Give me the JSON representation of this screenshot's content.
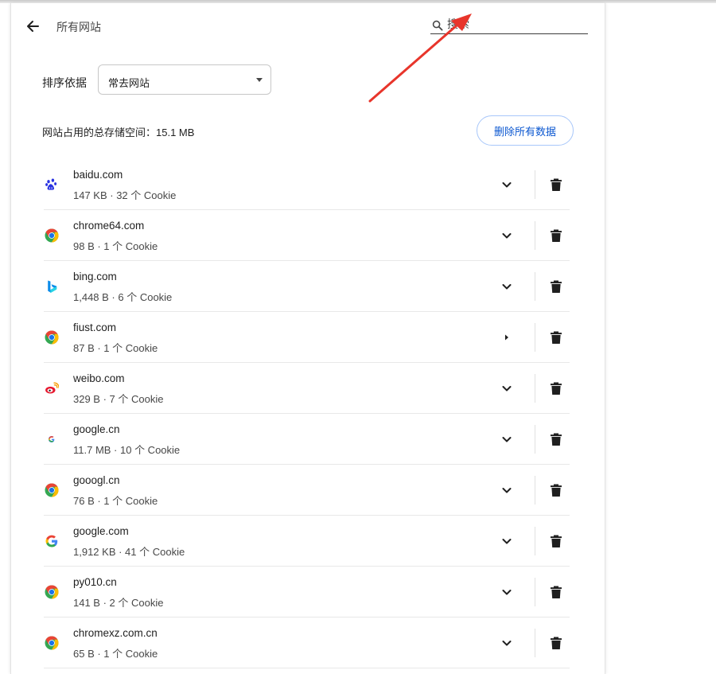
{
  "header": {
    "title": "所有网站",
    "search_placeholder": "搜索"
  },
  "sort": {
    "label": "排序依据",
    "selected": "常去网站"
  },
  "storage_summary": "网站占用的总存储空间：15.1 MB",
  "delete_all_label": "删除所有数据",
  "colors": {
    "accent_blue": "#0b57d0",
    "button_border": "#a8c7fa",
    "annotation_arrow": "#e8352b"
  },
  "sites": [
    {
      "name": "baidu.com",
      "meta": "147 KB · 32 个 Cookie",
      "icon": "baidu-paw-icon",
      "expand": "chevron-down-icon"
    },
    {
      "name": "chrome64.com",
      "meta": "98 B · 1 个 Cookie",
      "icon": "chrome-icon",
      "expand": "chevron-down-icon"
    },
    {
      "name": "bing.com",
      "meta": "1,448 B · 6 个 Cookie",
      "icon": "bing-icon",
      "expand": "chevron-down-icon"
    },
    {
      "name": "fiust.com",
      "meta": "87 B · 1 个 Cookie",
      "icon": "chrome-icon",
      "expand": "caret-right-icon"
    },
    {
      "name": "weibo.com",
      "meta": "329 B · 7 个 Cookie",
      "icon": "weibo-icon",
      "expand": "chevron-down-icon"
    },
    {
      "name": "google.cn",
      "meta": "11.7 MB · 10 个 Cookie",
      "icon": "google-small-icon",
      "expand": "chevron-down-icon"
    },
    {
      "name": "gooogl.cn",
      "meta": "76 B · 1 个 Cookie",
      "icon": "chrome-icon",
      "expand": "chevron-down-icon"
    },
    {
      "name": "google.com",
      "meta": "1,912 KB · 41 个 Cookie",
      "icon": "google-icon",
      "expand": "chevron-down-icon"
    },
    {
      "name": "py010.cn",
      "meta": "141 B · 2 个 Cookie",
      "icon": "chrome-icon",
      "expand": "chevron-down-icon"
    },
    {
      "name": "chromexz.com.cn",
      "meta": "65 B · 1 个 Cookie",
      "icon": "chrome-icon",
      "expand": "chevron-down-icon"
    }
  ]
}
